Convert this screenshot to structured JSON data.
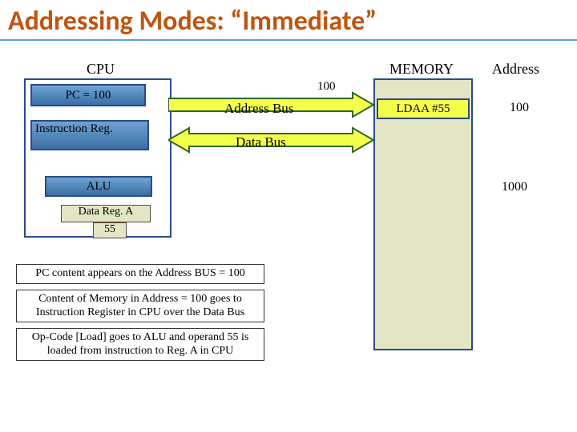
{
  "title": "Addressing Modes: “Immediate”",
  "headers": {
    "cpu": "CPU",
    "memory": "MEMORY",
    "address": "Address"
  },
  "cpu": {
    "pc": "PC = 100",
    "instr": "Instruction Reg.",
    "alu": "ALU",
    "dataRegLabel": "Data Reg. A",
    "dataRegValue": "55"
  },
  "memory": {
    "cell100": "LDAA #55",
    "addr100": "100",
    "addr1000": "1000"
  },
  "bus": {
    "addressLabel": "Address Bus",
    "dataLabel": "Data Bus",
    "addressValue": "100"
  },
  "notes": {
    "n1": "PC content appears on the Address BUS = 100",
    "n2": "Content  of Memory in Address = 100 goes to Instruction Register in CPU over the Data Bus",
    "n3": "Op-Code [Load] goes to ALU and operand 55 is loaded from instruction to Reg. A in CPU"
  }
}
